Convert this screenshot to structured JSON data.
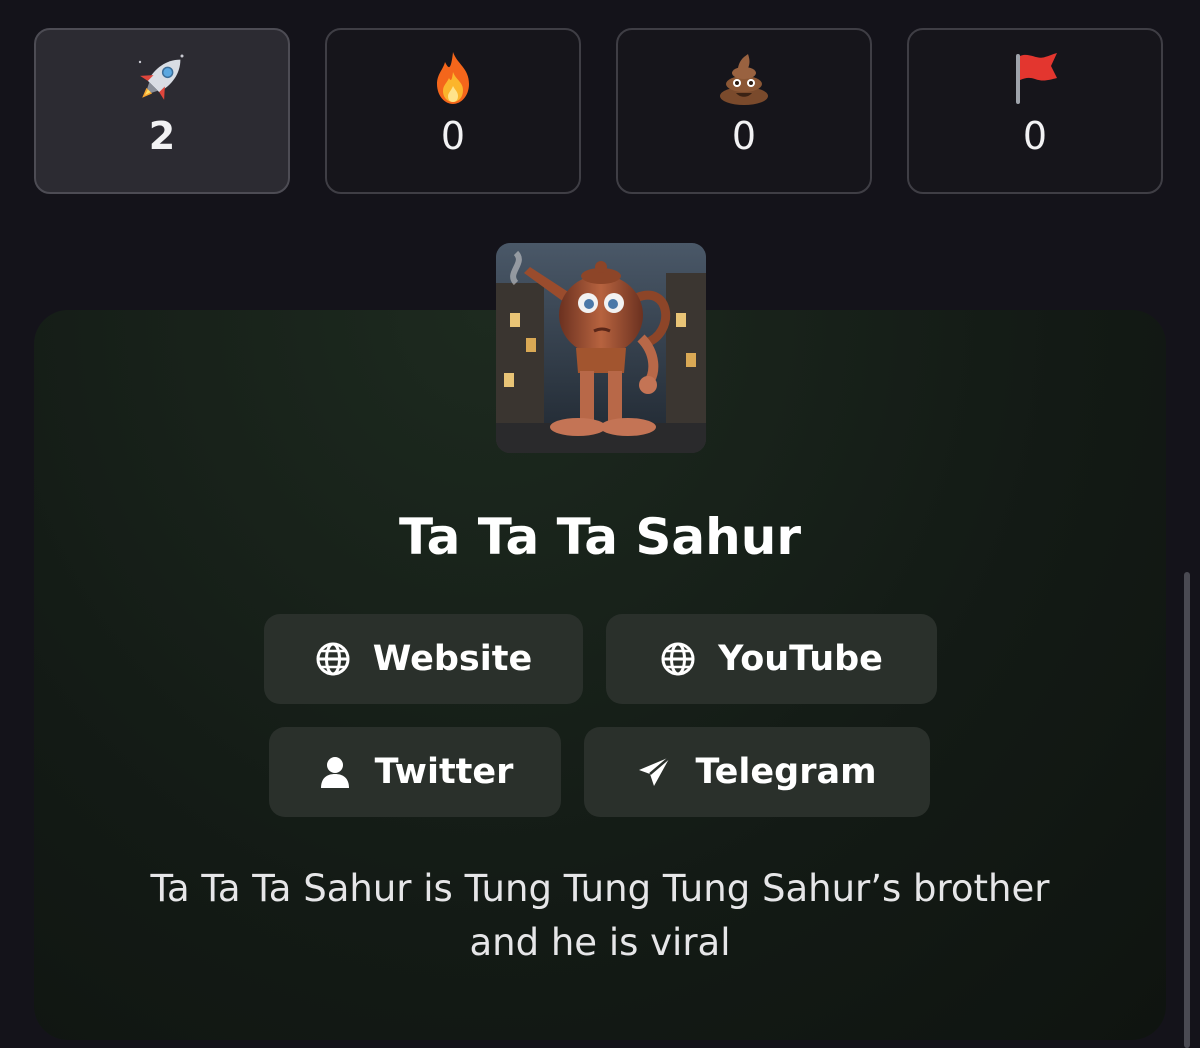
{
  "reactions": [
    {
      "icon": "rocket-icon",
      "count": "2",
      "active": true
    },
    {
      "icon": "fire-icon",
      "count": "0",
      "active": false
    },
    {
      "icon": "poop-icon",
      "count": "0",
      "active": false
    },
    {
      "icon": "red-flag-icon",
      "count": "0",
      "active": false
    }
  ],
  "token": {
    "name": "Ta Ta Ta Sahur",
    "description": "Ta Ta Ta Sahur is Tung Tung Tung Sahur’s brother and he is viral"
  },
  "links": {
    "website": {
      "label": "Website",
      "icon": "globe-icon"
    },
    "youtube": {
      "label": "YouTube",
      "icon": "globe-icon"
    },
    "twitter": {
      "label": "Twitter",
      "icon": "user-icon"
    },
    "telegram": {
      "label": "Telegram",
      "icon": "paper-plane-icon"
    }
  },
  "colors": {
    "background": "#14131a",
    "card_accent": "#1d2a1f",
    "button_bg": "#2a302b",
    "active_reaction_bg": "#2c2b32"
  }
}
